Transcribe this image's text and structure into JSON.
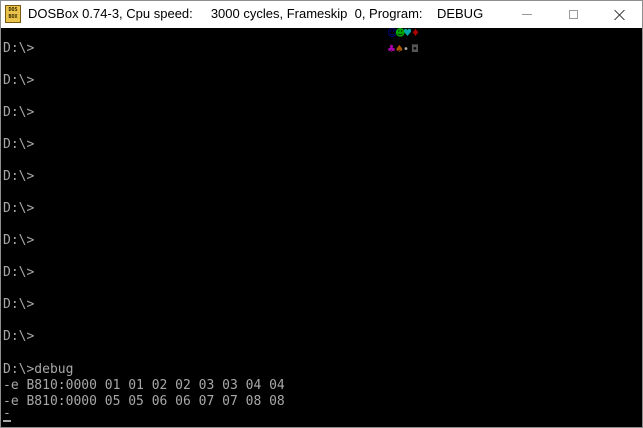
{
  "window": {
    "icon_label": "DOS BOX",
    "title": "DOSBox 0.74-3, Cpu speed:     3000 cycles, Frameskip  0, Program:    DEBUG",
    "controls": {
      "minimize_icon": "minimize-icon",
      "maximize_icon": "maximize-icon",
      "close_icon": "close-icon"
    }
  },
  "console": {
    "lines": [
      "D:\\>",
      "D:\\>",
      "D:\\>",
      "D:\\>",
      "D:\\>",
      "D:\\>",
      "D:\\>",
      "D:\\>",
      "D:\\>",
      "D:\\>",
      "D:\\>debug",
      "-e B810:0000 01 01 02 02 03 03 04 04",
      "-e B810:0000 05 05 06 06 07 07 08 08",
      "-"
    ],
    "text_color": "#a8a8a8",
    "background": "#000000"
  },
  "video_glyphs": {
    "row1": [
      {
        "char": "☺",
        "color": "#0000aa"
      },
      {
        "char": "☻",
        "color": "#00aa00"
      },
      {
        "char": "♥",
        "color": "#00aaaa"
      },
      {
        "char": "♦",
        "color": "#aa0000"
      }
    ],
    "row2": [
      {
        "char": "♣",
        "color": "#aa00aa"
      },
      {
        "char": "♠",
        "color": "#aa5500"
      },
      {
        "char": "•",
        "color": "#aaaaaa"
      },
      {
        "char": "◘",
        "color": "#555555"
      }
    ]
  }
}
